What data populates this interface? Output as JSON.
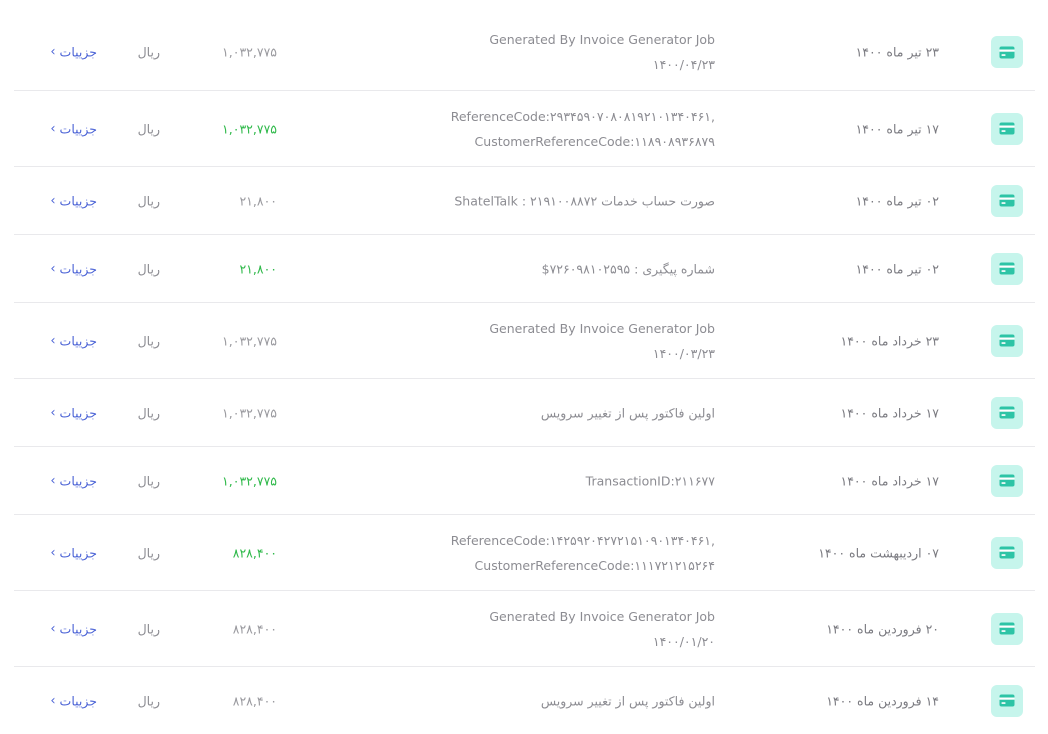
{
  "colors": {
    "accent": "#4b63d6",
    "positive": "#2fb94a",
    "icon_bg": "#c6f5ec",
    "icon_fg": "#2dc4a6"
  },
  "icon": "credit-card-icon",
  "details_label": "جزییات",
  "rows": [
    {
      "date": "۲۳ تیر ماه ۱۴۰۰",
      "desc": [
        "Generated By Invoice Generator Job",
        "۱۴۰۰/۰۴/۲۳"
      ],
      "amount": "۱,۰۳۲,۷۷۵",
      "positive": false,
      "currency": "ریال"
    },
    {
      "date": "۱۷ تیر ماه ۱۴۰۰",
      "desc": [
        "ReferenceCode:۲۹۳۴۵۹۰۷۰۸۰۸۱۹۲۱۰۱۳۴۰۴۶۱,",
        "CustomerReferenceCode:۱۱۸۹۰۸۹۳۶۸۷۹"
      ],
      "amount": "۱,۰۳۲,۷۷۵",
      "positive": true,
      "currency": "ریال"
    },
    {
      "date": "۰۲ تیر ماه ۱۴۰۰",
      "desc": [
        "صورت حساب خدمات ShatelTalk : ۲۱۹۱۰۰۸۸۷۲"
      ],
      "amount": "۲۱,۸۰۰",
      "positive": false,
      "currency": "ریال"
    },
    {
      "date": "۰۲ تیر ماه ۱۴۰۰",
      "desc": [
        "شماره پیگیری : ۷۲۶۰۹۸۱۰۲۵۹۵$"
      ],
      "amount": "۲۱,۸۰۰",
      "positive": true,
      "currency": "ریال"
    },
    {
      "date": "۲۳ خرداد ماه ۱۴۰۰",
      "desc": [
        "Generated By Invoice Generator Job",
        "۱۴۰۰/۰۳/۲۳"
      ],
      "amount": "۱,۰۳۲,۷۷۵",
      "positive": false,
      "currency": "ریال"
    },
    {
      "date": "۱۷ خرداد ماه ۱۴۰۰",
      "desc": [
        "اولین فاکتور پس از تغییر سرویس"
      ],
      "amount": "۱,۰۳۲,۷۷۵",
      "positive": false,
      "currency": "ریال"
    },
    {
      "date": "۱۷ خرداد ماه ۱۴۰۰",
      "desc": [
        "TransactionID:۲۱۱۶۷۷"
      ],
      "amount": "۱,۰۳۲,۷۷۵",
      "positive": true,
      "currency": "ریال"
    },
    {
      "date": "۰۷ اردیبهشت ماه ۱۴۰۰",
      "desc": [
        "ReferenceCode:۱۴۲۵۹۲۰۴۲۷۲۱۵۱۰۹۰۱۳۴۰۴۶۱,",
        "CustomerReferenceCode:۱۱۱۷۲۱۲۱۵۲۶۴"
      ],
      "amount": "۸۲۸,۴۰۰",
      "positive": true,
      "currency": "ریال"
    },
    {
      "date": "۲۰ فروردین ماه ۱۴۰۰",
      "desc": [
        "Generated By Invoice Generator Job",
        "۱۴۰۰/۰۱/۲۰"
      ],
      "amount": "۸۲۸,۴۰۰",
      "positive": false,
      "currency": "ریال"
    },
    {
      "date": "۱۴ فروردین ماه ۱۴۰۰",
      "desc": [
        "اولین فاکتور پس از تغییر سرویس"
      ],
      "amount": "۸۲۸,۴۰۰",
      "positive": false,
      "currency": "ریال"
    }
  ]
}
